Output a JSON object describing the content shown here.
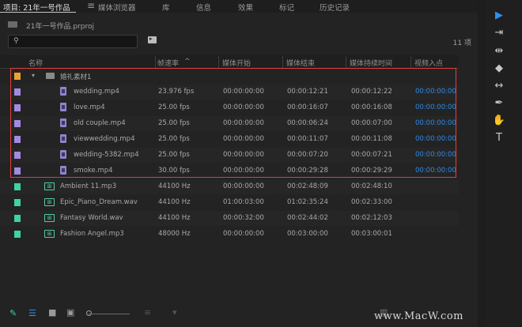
{
  "tabs": [
    "项目: 21年一号作品",
    "媒体浏览器",
    "库",
    "信息",
    "效果",
    "标记",
    "历史记录"
  ],
  "panel_menu_icon": "hamburger-menu-icon",
  "project_file": "21年一号作品.prproj",
  "search": {
    "value": "",
    "placeholder": ""
  },
  "item_count": "11 项",
  "columns": [
    "名称",
    "帧速率",
    "媒体开始",
    "媒体结束",
    "媒体持续时间",
    "视频入点"
  ],
  "sort_arrow": "^",
  "folder": {
    "name": "婚礼素材1",
    "color": "#f0a030"
  },
  "video_items": [
    {
      "name": "wedding.mp4",
      "fps": "23.976 fps",
      "start": "00:00:00:00",
      "end": "00:00:12:21",
      "duration": "00:00:12:22",
      "in": "00:00:00:00"
    },
    {
      "name": "love.mp4",
      "fps": "25.00 fps",
      "start": "00:00:00:00",
      "end": "00:00:16:07",
      "duration": "00:00:16:08",
      "in": "00:00:00:00"
    },
    {
      "name": "old couple.mp4",
      "fps": "25.00 fps",
      "start": "00:00:00:00",
      "end": "00:00:06:24",
      "duration": "00:00:07:00",
      "in": "00:00:00:00"
    },
    {
      "name": "viewwedding.mp4",
      "fps": "25.00 fps",
      "start": "00:00:00:00",
      "end": "00:00:11:07",
      "duration": "00:00:11:08",
      "in": "00:00:00:00"
    },
    {
      "name": "wedding-5382.mp4",
      "fps": "25.00 fps",
      "start": "00:00:00:00",
      "end": "00:00:07:20",
      "duration": "00:00:07:21",
      "in": "00:00:00:00"
    },
    {
      "name": "smoke.mp4",
      "fps": "30.00 fps",
      "start": "00:00:00:00",
      "end": "00:00:29:28",
      "duration": "00:00:29:29",
      "in": "00:00:00:00"
    }
  ],
  "audio_items": [
    {
      "name": "Ambient 11.mp3",
      "rate": "44100 Hz",
      "start": "00:00:00:00",
      "end": "00:02:48:09",
      "duration": "00:02:48:10"
    },
    {
      "name": "Epic_Piano_Dream.wav",
      "rate": "44100 Hz",
      "start": "01:00:03:00",
      "end": "01:02:35:24",
      "duration": "00:02:33:00"
    },
    {
      "name": "Fantasy World.wav",
      "rate": "44100 Hz",
      "start": "00:00:32:00",
      "end": "00:02:44:02",
      "duration": "00:02:12:03"
    },
    {
      "name": "Fashion Angel.mp3",
      "rate": "48000 Hz",
      "start": "00:00:00:00",
      "end": "00:03:00:00",
      "duration": "00:03:00:01"
    }
  ],
  "colors": {
    "video_label": "#a18be0",
    "audio_label": "#3ed3a3",
    "folder_label": "#f0a030",
    "timecode_blue": "#2e8ae6",
    "highlight": "#e0413a"
  },
  "tools": [
    "selection-tool-icon",
    "track-select-tool-icon",
    "ripple-edit-tool-icon",
    "razor-tool-icon",
    "slip-tool-icon",
    "pen-tool-icon",
    "hand-tool-icon",
    "type-tool-icon"
  ],
  "watermark": "www.MacW.com"
}
